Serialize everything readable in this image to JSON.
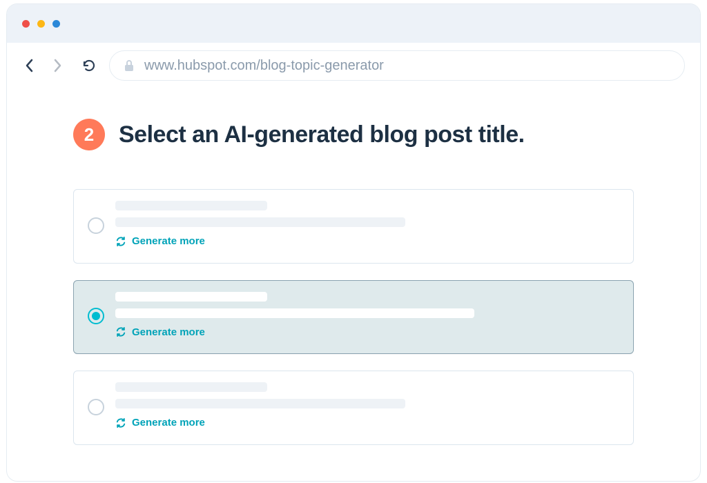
{
  "browser": {
    "url": "www.hubspot.com/blog-topic-generator"
  },
  "step": {
    "number": "2",
    "title": "Select an AI-generated blog post title."
  },
  "options": [
    {
      "selected": false,
      "generate_label": "Generate more"
    },
    {
      "selected": true,
      "generate_label": "Generate more"
    },
    {
      "selected": false,
      "generate_label": "Generate more"
    }
  ]
}
